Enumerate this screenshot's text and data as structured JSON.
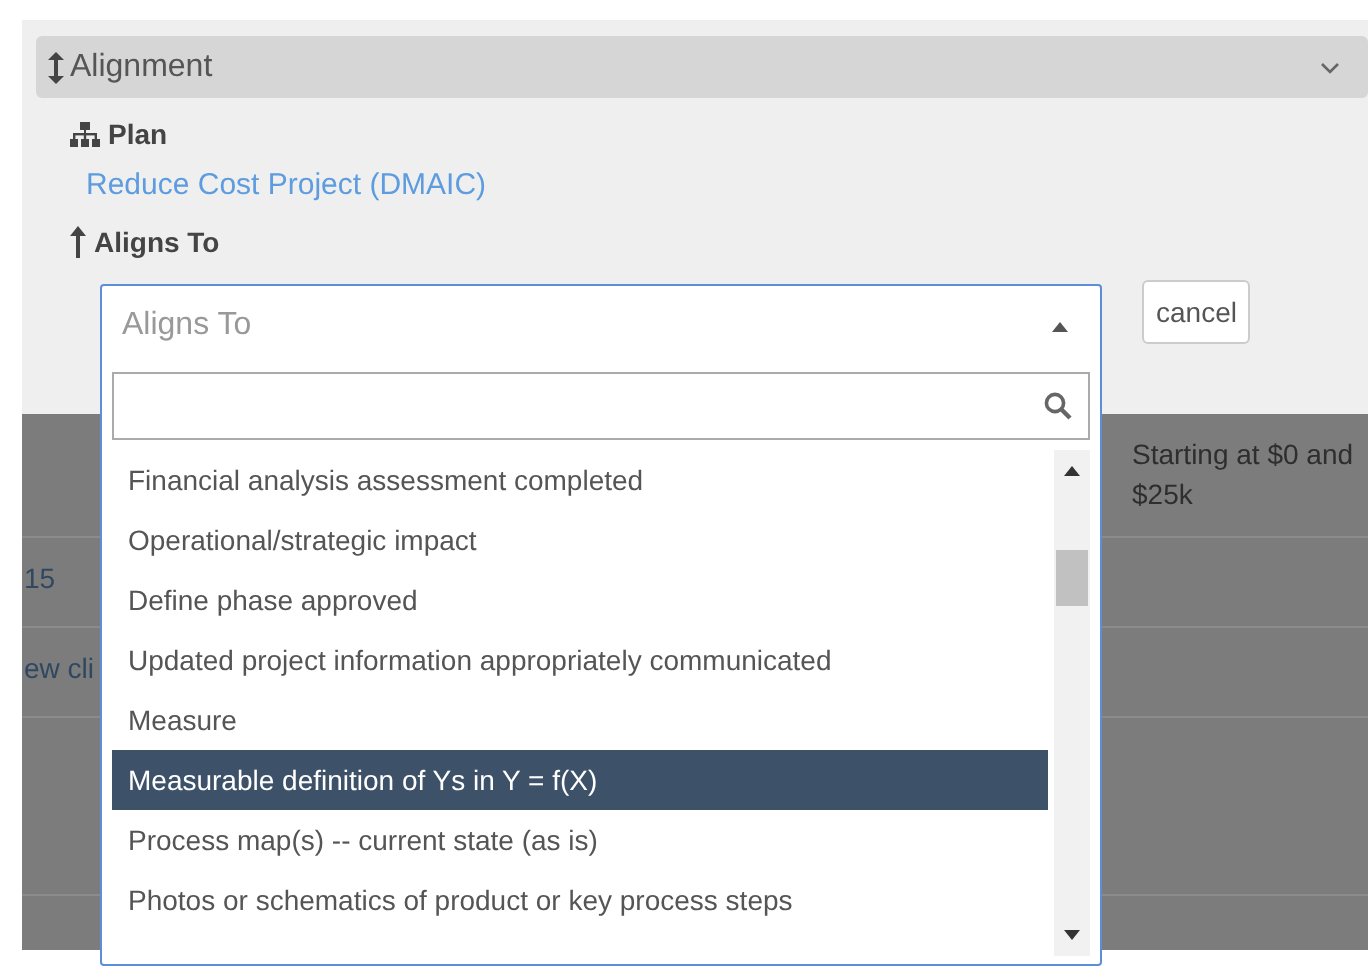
{
  "section": {
    "title": "Alignment",
    "expanded": true
  },
  "plan": {
    "label": "Plan",
    "link": "Reduce Cost Project (DMAIC)"
  },
  "aligns_to": {
    "label": "Aligns To",
    "select": {
      "placeholder": "Aligns To",
      "open": true
    },
    "cancel_button": "cancel",
    "options": [
      {
        "label": "Financial analysis assessment completed",
        "selected": false
      },
      {
        "label": "Operational/strategic impact",
        "selected": false
      },
      {
        "label": "Define phase approved",
        "selected": false
      },
      {
        "label": "Updated project information appropriately communicated",
        "selected": false
      },
      {
        "label": "Measure",
        "selected": false
      },
      {
        "label": "Measurable definition of Ys in Y = f(X)",
        "selected": true
      },
      {
        "label": "Process map(s) -- current state (as is)",
        "selected": false
      },
      {
        "label": "Photos or schematics of product or key process steps",
        "selected": false
      }
    ]
  },
  "background_table": {
    "rows": [
      {
        "column_1": "",
        "column_2": [
          "Starting at $0 and",
          "$25k"
        ]
      },
      {
        "column_1": "15",
        "column_2": []
      },
      {
        "column_1": "ew cli",
        "column_2": []
      },
      {
        "column_1": "",
        "column_2": []
      }
    ]
  }
}
